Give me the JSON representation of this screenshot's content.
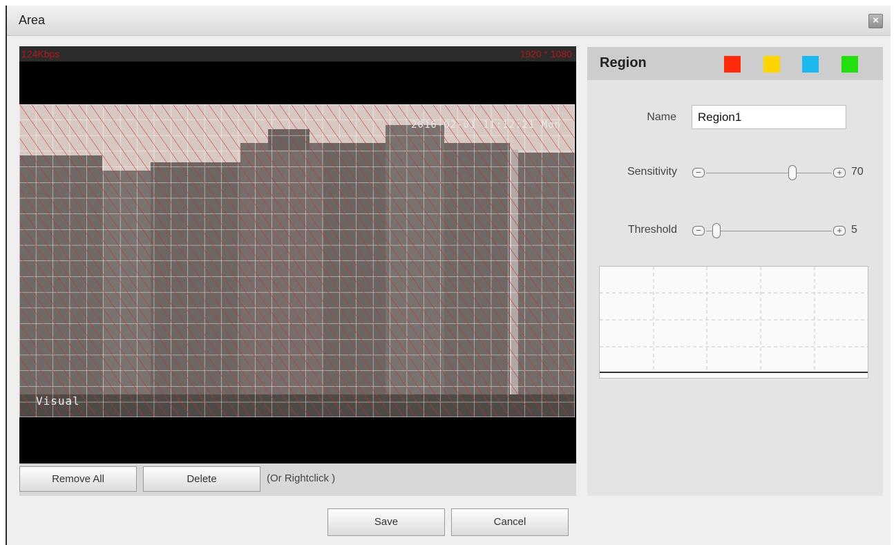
{
  "window": {
    "title": "Area",
    "close_symbol": "×"
  },
  "video": {
    "bitrate": "124Kbps",
    "resolution": "1920 * 1080",
    "timestamp": "2016-02-01 11:12:21 Mon",
    "mode_label": "Visual"
  },
  "left_buttons": {
    "remove_all": "Remove All",
    "delete": "Delete",
    "hint": "(Or Rightclick )"
  },
  "region": {
    "title": "Region",
    "colors": [
      "#ff2a0a",
      "#ffd400",
      "#1ab8ee",
      "#25e010"
    ],
    "name_label": "Name",
    "name_value": "Region1",
    "sensitivity_label": "Sensitivity",
    "sensitivity_value": "70",
    "threshold_label": "Threshold",
    "threshold_value": "5",
    "minus_symbol": "−",
    "plus_symbol": "+"
  },
  "footer": {
    "save": "Save",
    "cancel": "Cancel"
  }
}
